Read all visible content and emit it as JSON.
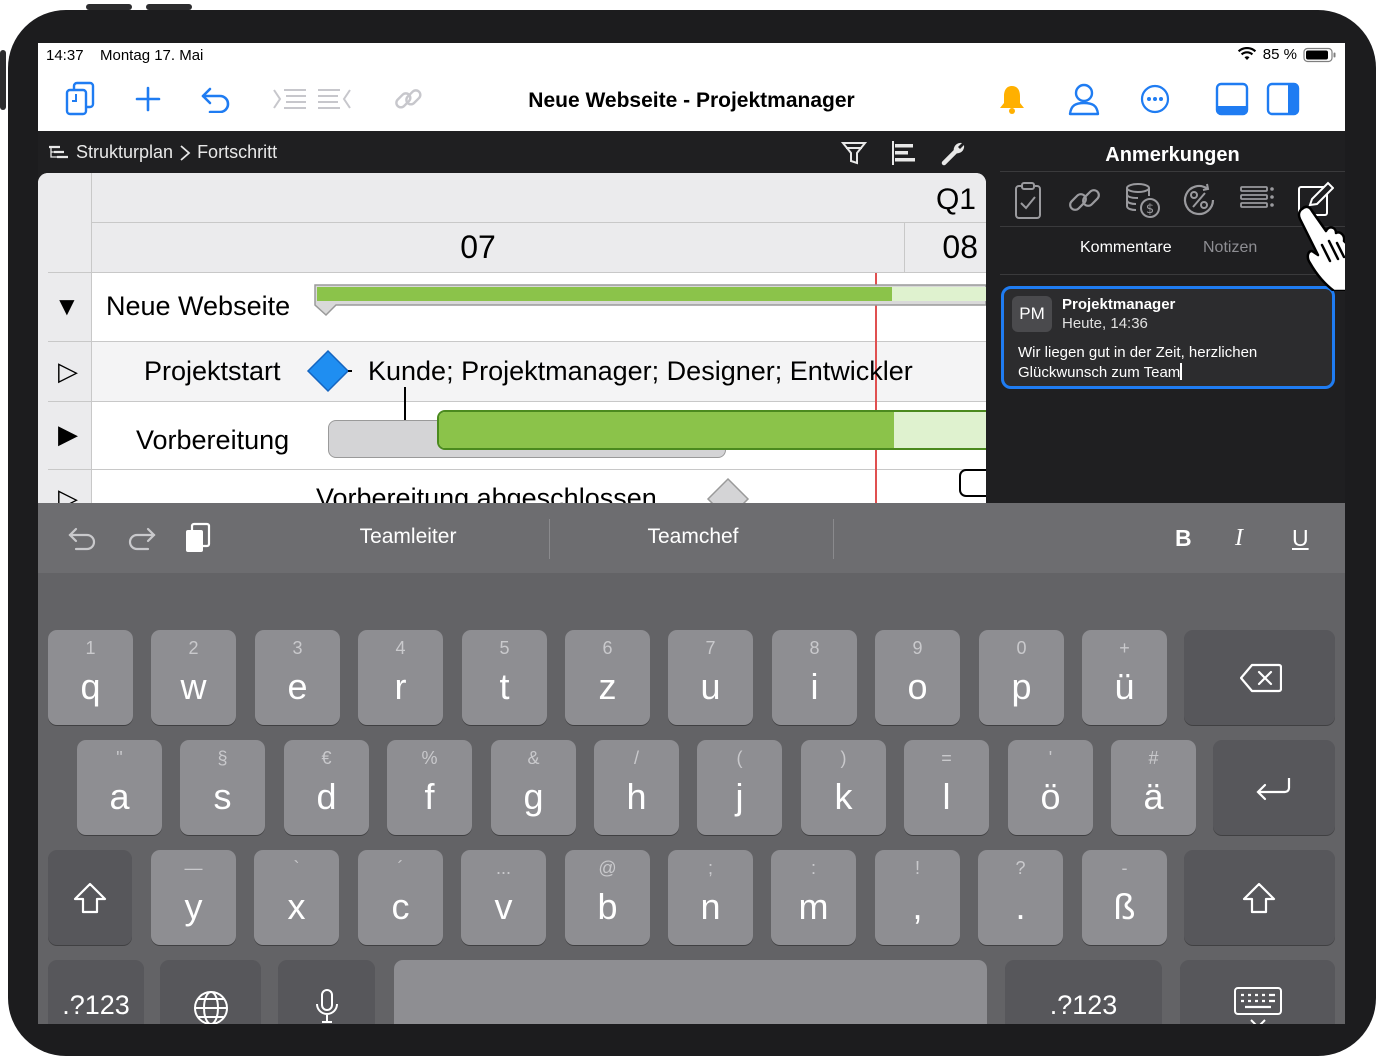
{
  "status": {
    "time": "14:37",
    "date": "Montag 17. Mai",
    "battery": "85 %"
  },
  "toolbar": {
    "title": "Neue Webseite - Projektmanager",
    "icons": [
      "copy-icon",
      "plus-icon",
      "undo-icon",
      "indent-icon",
      "outdent-icon",
      "link-icon",
      "bell-icon",
      "person-icon",
      "more-icon",
      "bottom-panel-icon",
      "side-panel-icon"
    ]
  },
  "breadcrumb": {
    "items": [
      "Strukturplan",
      "Fortschritt"
    ]
  },
  "gantt": {
    "quarter": "Q1",
    "weeks": [
      "07",
      "08"
    ],
    "rows": [
      {
        "name": "Neue Webseite",
        "toggle": "▼",
        "progress": 0.62
      },
      {
        "name": "Projektstart",
        "toggle": "▷",
        "resources": "Kunde; Projektmanager; Designer; Entwickler"
      },
      {
        "name": "Vorbereitung",
        "toggle": "▶",
        "progress": 0.83
      },
      {
        "name": "Vorbereitung abgeschlossen",
        "toggle": "▷"
      }
    ]
  },
  "panel": {
    "title": "Anmerkungen",
    "tabs": [
      "Kommentare",
      "Notizen"
    ],
    "active_tab": "Kommentare",
    "comment": {
      "initials": "PM",
      "author": "Projektmanager",
      "time": "Heute, 14:36",
      "text_line1": "Wir liegen gut in der Zeit, herzlichen",
      "text_line2": "Glückwunsch zum Team"
    }
  },
  "keyboard": {
    "suggestions": [
      "Teamleiter",
      "Teamchef"
    ],
    "format": {
      "bold": "B",
      "italic": "I",
      "underline": "U"
    },
    "row1": [
      {
        "sub": "1",
        "main": "q"
      },
      {
        "sub": "2",
        "main": "w"
      },
      {
        "sub": "3",
        "main": "e"
      },
      {
        "sub": "4",
        "main": "r"
      },
      {
        "sub": "5",
        "main": "t"
      },
      {
        "sub": "6",
        "main": "z"
      },
      {
        "sub": "7",
        "main": "u"
      },
      {
        "sub": "8",
        "main": "i"
      },
      {
        "sub": "9",
        "main": "o"
      },
      {
        "sub": "0",
        "main": "p"
      },
      {
        "sub": "+",
        "main": "ü"
      }
    ],
    "row2": [
      {
        "sub": "\"",
        "main": "a"
      },
      {
        "sub": "§",
        "main": "s"
      },
      {
        "sub": "€",
        "main": "d"
      },
      {
        "sub": "%",
        "main": "f"
      },
      {
        "sub": "&",
        "main": "g"
      },
      {
        "sub": "/",
        "main": "h"
      },
      {
        "sub": "(",
        "main": "j"
      },
      {
        "sub": ")",
        "main": "k"
      },
      {
        "sub": "=",
        "main": "l"
      },
      {
        "sub": "'",
        "main": "ö"
      },
      {
        "sub": "#",
        "main": "ä"
      }
    ],
    "row3": [
      {
        "sub": "—",
        "main": "y"
      },
      {
        "sub": "`",
        "main": "x"
      },
      {
        "sub": "´",
        "main": "c"
      },
      {
        "sub": "...",
        "main": "v"
      },
      {
        "sub": "@",
        "main": "b"
      },
      {
        "sub": ";",
        "main": "n"
      },
      {
        "sub": ":",
        "main": "m"
      },
      {
        "sub": "!",
        "main": ","
      },
      {
        "sub": "?",
        "main": "."
      },
      {
        "sub": "-",
        "main": "ß"
      }
    ],
    "numbers_label": ".?123"
  }
}
